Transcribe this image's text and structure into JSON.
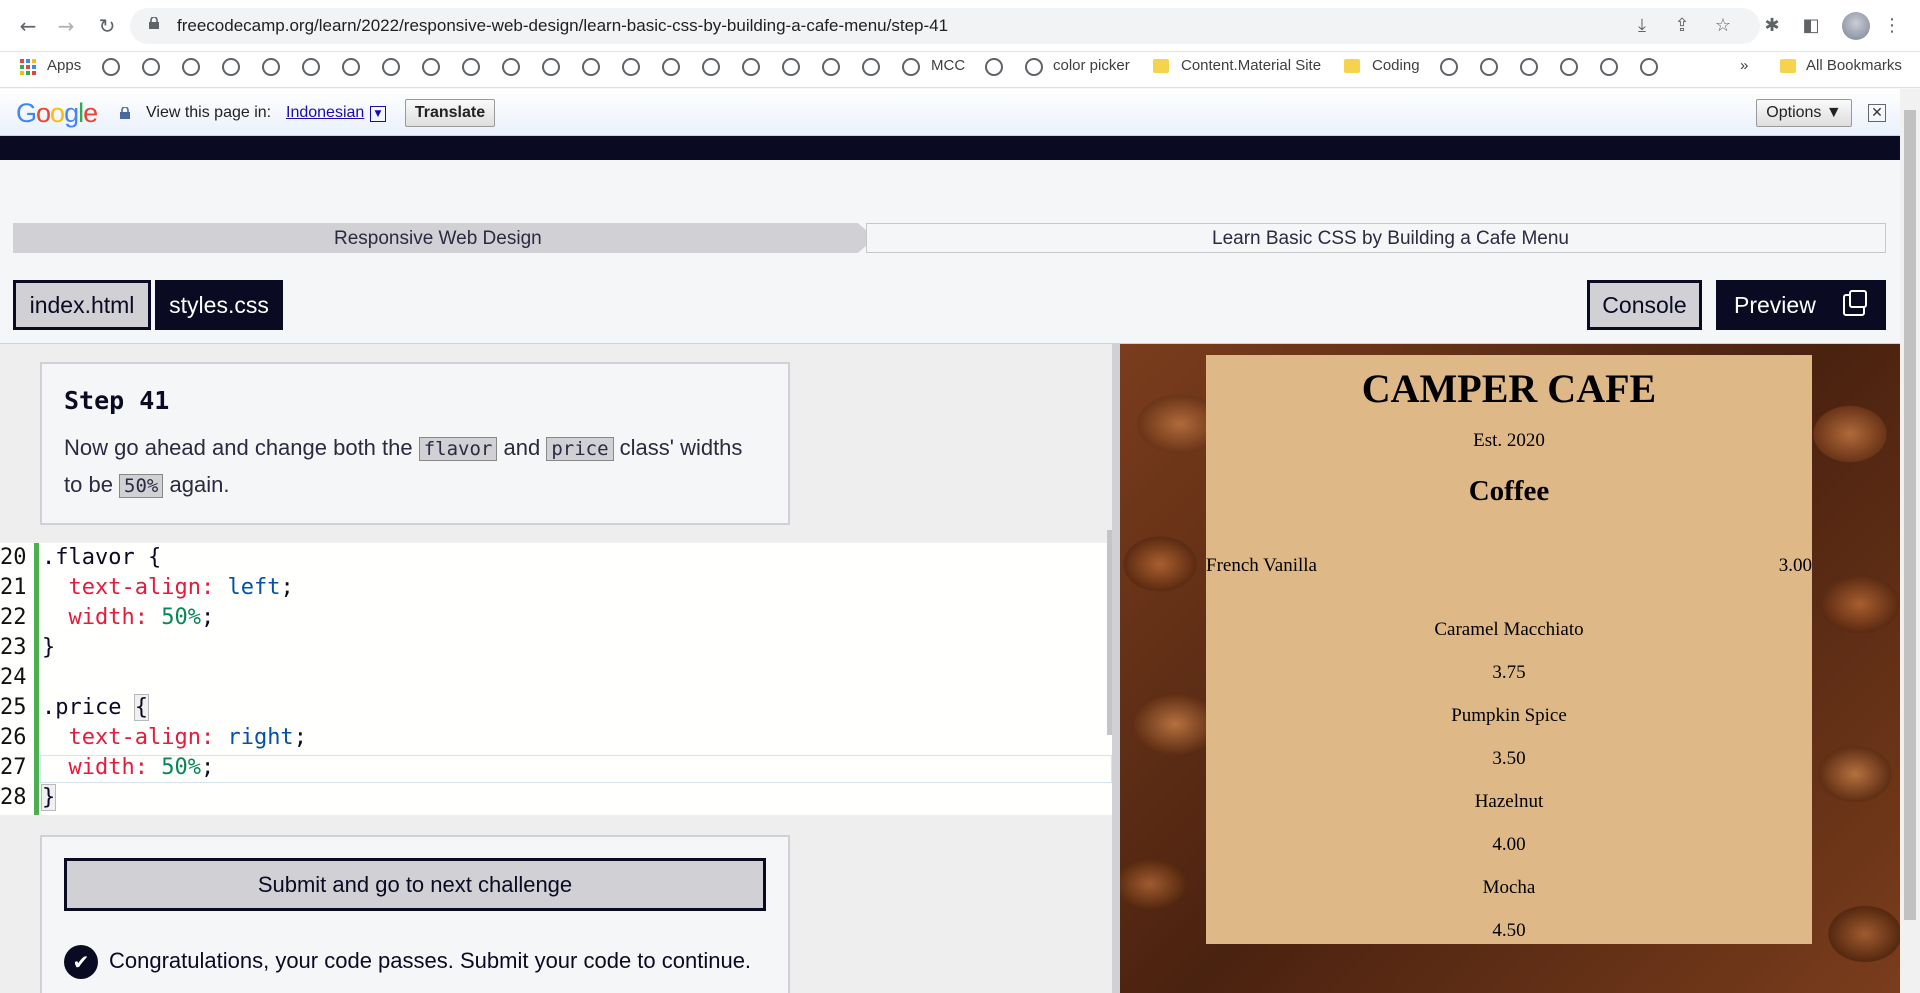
{
  "browser": {
    "url": "freecodecamp.org/learn/2022/responsive-web-design/learn-basic-css-by-building-a-cafe-menu/step-41",
    "bookmarks": {
      "apps": "Apps",
      "mcc": "MCC",
      "color_picker": "color picker",
      "content_material": "Content.Material Site",
      "coding": "Coding",
      "overflow": "»",
      "all_bookmarks": "All Bookmarks"
    }
  },
  "translate_bar": {
    "logo": "Google",
    "view_label": "View this page in:",
    "language": "Indonesian",
    "translate_button": "Translate",
    "options_button": "Options ▼",
    "close": "✕"
  },
  "breadcrumb": {
    "superblock": "Responsive Web Design",
    "block": "Learn Basic CSS by Building a Cafe Menu"
  },
  "editor_tabs": {
    "index": "index.html",
    "styles": "styles.css",
    "console": "Console",
    "preview": "Preview"
  },
  "instructions": {
    "title": "Step 41",
    "text_before": "Now go ahead and change both the ",
    "code_flavor": "flavor",
    "text_and": " and ",
    "code_price": "price",
    "text_middle": " class' widths to be ",
    "code_50": "50%",
    "text_after": " again."
  },
  "code": {
    "lines": [
      {
        "num": "20",
        "selector": ".flavor {"
      },
      {
        "num": "21",
        "prop": "text-align:",
        "value": "left",
        "end": ";"
      },
      {
        "num": "22",
        "prop": "width:",
        "value": "50%",
        "end": ";"
      },
      {
        "num": "23",
        "text": "}"
      },
      {
        "num": "24",
        "text": ""
      },
      {
        "num": "25",
        "selector": ".price ",
        "brace": "{"
      },
      {
        "num": "26",
        "prop": "text-align:",
        "value": "right",
        "end": ";"
      },
      {
        "num": "27",
        "prop": "width:",
        "value": "50%",
        "end": ";"
      },
      {
        "num": "28",
        "text": "}"
      }
    ]
  },
  "submit": {
    "button": "Submit and go to next challenge",
    "message": "Congratulations, your code passes. Submit your code to continue."
  },
  "preview": {
    "title": "CAMPER CAFE",
    "est": "Est. 2020",
    "section": "Coffee",
    "items": [
      {
        "flavor": "French Vanilla",
        "price": "3.00"
      },
      {
        "flavor": "Caramel Macchiato",
        "price": "3.75"
      },
      {
        "flavor": "Pumpkin Spice",
        "price": "3.50"
      },
      {
        "flavor": "Hazelnut",
        "price": "4.00"
      },
      {
        "flavor": "Mocha",
        "price": "4.50"
      }
    ],
    "card_color": "#deb887"
  },
  "colors": {
    "fcc_dark": "#0a0a23",
    "fcc_gray": "#d0d0d5",
    "accent_green": "#4caf50"
  }
}
